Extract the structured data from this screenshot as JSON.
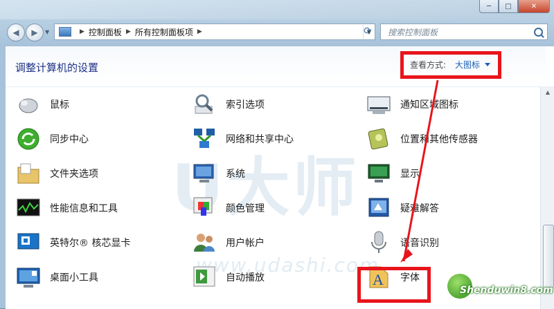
{
  "window": {
    "minimize": "─",
    "maximize": "□",
    "close": "✕"
  },
  "nav": {
    "back": "◀",
    "forward": "▶"
  },
  "address": {
    "crumbs": [
      "控制面板",
      "所有控制面板项"
    ]
  },
  "search": {
    "placeholder": "搜索控制面板"
  },
  "header": {
    "title": "调整计算机的设置",
    "view_by_label": "查看方式:",
    "view_by_value": "大图标"
  },
  "items": [
    {
      "label": "鼠标",
      "icon": "mouse-icon"
    },
    {
      "label": "索引选项",
      "icon": "indexing-options-icon"
    },
    {
      "label": "通知区域图标",
      "icon": "notification-area-icon"
    },
    {
      "label": "同步中心",
      "icon": "sync-center-icon"
    },
    {
      "label": "网络和共享中心",
      "icon": "network-sharing-icon"
    },
    {
      "label": "位置和其他传感器",
      "icon": "location-sensor-icon"
    },
    {
      "label": "文件夹选项",
      "icon": "folder-options-icon"
    },
    {
      "label": "系统",
      "icon": "system-icon"
    },
    {
      "label": "显示",
      "icon": "display-icon"
    },
    {
      "label": "性能信息和工具",
      "icon": "performance-icon"
    },
    {
      "label": "颜色管理",
      "icon": "color-management-icon"
    },
    {
      "label": "疑难解答",
      "icon": "troubleshooting-icon"
    },
    {
      "label": "英特尔® 核芯显卡",
      "icon": "intel-graphics-icon"
    },
    {
      "label": "用户帐户",
      "icon": "user-accounts-icon"
    },
    {
      "label": "语音识别",
      "icon": "speech-recognition-icon"
    },
    {
      "label": "桌面小工具",
      "icon": "desktop-gadgets-icon"
    },
    {
      "label": "自动播放",
      "icon": "autoplay-icon"
    },
    {
      "label": "字体",
      "icon": "fonts-icon"
    }
  ],
  "watermark": {
    "text": "U大师",
    "url": "www.udashi.com"
  },
  "site_logo": {
    "text": "Shenduwin8.com"
  },
  "colors": {
    "highlight": "#e8141b",
    "link": "#1a5eb5",
    "title": "#1e3287"
  }
}
